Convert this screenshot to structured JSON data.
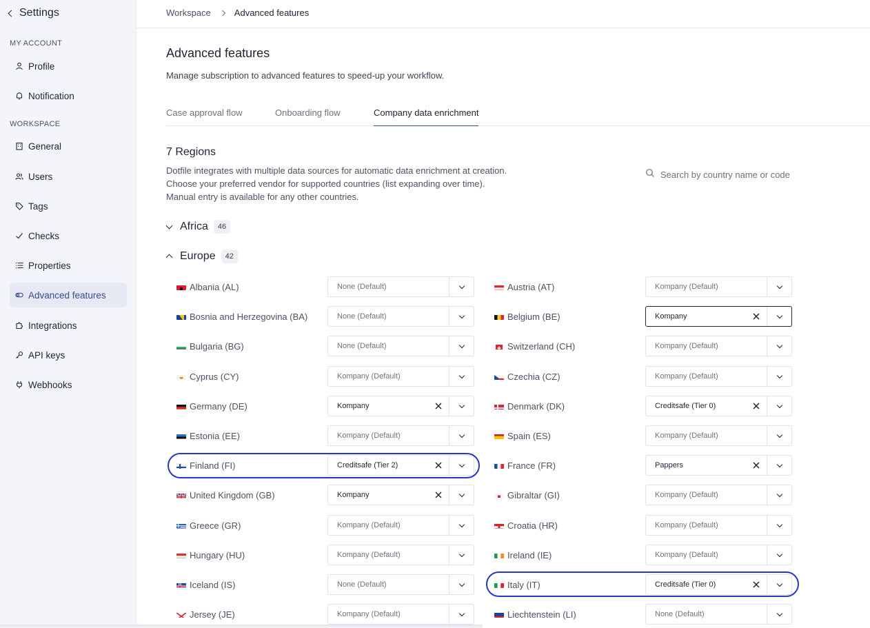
{
  "sidebar": {
    "back_label": "Settings",
    "sections": {
      "my_account": "MY ACCOUNT",
      "workspace": "WORKSPACE"
    },
    "items": [
      {
        "label": "Profile",
        "icon": "user-icon",
        "active": false
      },
      {
        "label": "Notification",
        "icon": "bell-icon",
        "active": false
      },
      {
        "label": "General",
        "icon": "building-icon",
        "active": false
      },
      {
        "label": "Users",
        "icon": "users-icon",
        "active": false
      },
      {
        "label": "Tags",
        "icon": "tag-icon",
        "active": false
      },
      {
        "label": "Checks",
        "icon": "check-icon",
        "active": false
      },
      {
        "label": "Properties",
        "icon": "list-icon",
        "active": false
      },
      {
        "label": "Advanced features",
        "icon": "toggle-icon",
        "active": true
      },
      {
        "label": "Integrations",
        "icon": "puzzle-icon",
        "active": false
      },
      {
        "label": "API keys",
        "icon": "key-icon",
        "active": false
      },
      {
        "label": "Webhooks",
        "icon": "webhook-icon",
        "active": false
      }
    ]
  },
  "breadcrumb": {
    "parent": "Workspace",
    "current": "Advanced features"
  },
  "page": {
    "title": "Advanced features",
    "description": "Manage subscription to advanced features to speed-up your workflow."
  },
  "tabs": [
    {
      "label": "Case approval flow",
      "active": false
    },
    {
      "label": "Onboarding flow",
      "active": false
    },
    {
      "label": "Company data enrichment",
      "active": true
    }
  ],
  "regions": {
    "title": "7 Regions",
    "description": [
      "Dotfile integrates with multiple data sources for automatic data enrichment at creation.",
      "Choose your preferred vendor for supported countries (list expanding over time).",
      "Manual entry is available for any other countries."
    ],
    "search_placeholder": "Search by country name or code"
  },
  "groups": [
    {
      "name": "Africa",
      "count": "46",
      "expanded": false
    },
    {
      "name": "Europe",
      "count": "42",
      "expanded": true
    }
  ],
  "colors": {
    "accent": "#3a4a8c",
    "highlight": "#2536c9",
    "sidebar_bg": "#f3f5fb"
  },
  "countries_left": [
    {
      "name": "Albania (AL)",
      "flag": "AL",
      "value": "None (Default)",
      "set": false
    },
    {
      "name": "Bosnia and Herzegovina (BA)",
      "flag": "BA",
      "value": "None (Default)",
      "set": false
    },
    {
      "name": "Bulgaria (BG)",
      "flag": "BG",
      "value": "None (Default)",
      "set": false
    },
    {
      "name": "Cyprus (CY)",
      "flag": "CY",
      "value": "Kompany (Default)",
      "set": false
    },
    {
      "name": "Germany (DE)",
      "flag": "DE",
      "value": "Kompany",
      "set": true
    },
    {
      "name": "Estonia (EE)",
      "flag": "EE",
      "value": "Kompany (Default)",
      "set": false
    },
    {
      "name": "Finland (FI)",
      "flag": "FI",
      "value": "Creditsafe (Tier 2)",
      "set": true,
      "highlighted": true
    },
    {
      "name": "United Kingdom (GB)",
      "flag": "GB",
      "value": "Kompany",
      "set": true
    },
    {
      "name": "Greece (GR)",
      "flag": "GR",
      "value": "Kompany (Default)",
      "set": false
    },
    {
      "name": "Hungary (HU)",
      "flag": "HU",
      "value": "Kompany (Default)",
      "set": false
    },
    {
      "name": "Iceland (IS)",
      "flag": "IS",
      "value": "None (Default)",
      "set": false
    },
    {
      "name": "Jersey (JE)",
      "flag": "JE",
      "value": "Kompany (Default)",
      "set": false
    }
  ],
  "countries_right": [
    {
      "name": "Austria (AT)",
      "flag": "AT",
      "value": "Kompany (Default)",
      "set": false
    },
    {
      "name": "Belgium (BE)",
      "flag": "BE",
      "value": "Kompany",
      "set": true,
      "focused": true
    },
    {
      "name": "Switzerland (CH)",
      "flag": "CH",
      "value": "Kompany (Default)",
      "set": false
    },
    {
      "name": "Czechia (CZ)",
      "flag": "CZ",
      "value": "Kompany (Default)",
      "set": false
    },
    {
      "name": "Denmark (DK)",
      "flag": "DK",
      "value": "Creditsafe (Tier 0)",
      "set": true
    },
    {
      "name": "Spain (ES)",
      "flag": "ES",
      "value": "Kompany (Default)",
      "set": false
    },
    {
      "name": "France (FR)",
      "flag": "FR",
      "value": "Pappers",
      "set": true
    },
    {
      "name": "Gibraltar (GI)",
      "flag": "GI",
      "value": "Kompany (Default)",
      "set": false
    },
    {
      "name": "Croatia (HR)",
      "flag": "HR",
      "value": "Kompany (Default)",
      "set": false
    },
    {
      "name": "Ireland (IE)",
      "flag": "IE",
      "value": "Kompany (Default)",
      "set": false
    },
    {
      "name": "Italy (IT)",
      "flag": "IT",
      "value": "Creditsafe (Tier 0)",
      "set": true,
      "highlighted": true
    },
    {
      "name": "Liechtenstein (LI)",
      "flag": "LI",
      "value": "None (Default)",
      "set": false
    }
  ]
}
